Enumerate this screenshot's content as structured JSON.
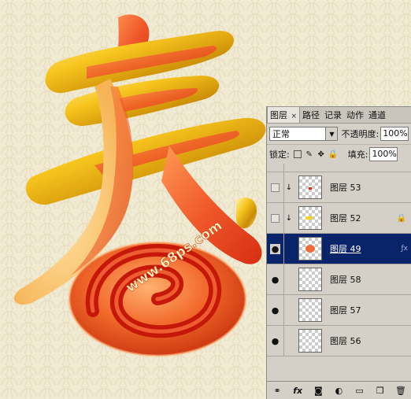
{
  "watermark": "www.68ps.com",
  "panel": {
    "tabs": [
      {
        "label": "图层",
        "active": true,
        "closable": true
      },
      {
        "label": "路径"
      },
      {
        "label": "记录"
      },
      {
        "label": "动作"
      },
      {
        "label": "通道"
      }
    ],
    "blend_mode": "正常",
    "opacity_label": "不透明度:",
    "opacity_value": "100%",
    "lock_label": "锁定:",
    "fill_label": "填充:",
    "fill_value": "100%",
    "layers": [
      {
        "name": "",
        "visible": false,
        "clipped": false,
        "partial": true
      },
      {
        "name": "图层 53",
        "visible": false,
        "clipped": true,
        "thumb": "red-dot"
      },
      {
        "name": "图层 52",
        "visible": false,
        "clipped": true,
        "thumb": "yellow-dot",
        "locked": true
      },
      {
        "name": "图层 49",
        "visible": true,
        "clipped": false,
        "selected": true,
        "thumb": "spiral",
        "fx": true
      },
      {
        "name": "图层 58",
        "visible": true,
        "clipped": false
      },
      {
        "name": "图层 57",
        "visible": true,
        "clipped": false
      },
      {
        "name": "图层 56",
        "visible": true,
        "clipped": false
      }
    ],
    "footer_icons": [
      "link-icon",
      "fx-icon",
      "mask-icon",
      "adjustment-icon",
      "group-icon",
      "new-layer-icon",
      "trash-icon"
    ]
  },
  "colors": {
    "selection": "#0a246a",
    "panel_bg": "#d4d0c8",
    "canvas_bg": "#f1ead2"
  }
}
